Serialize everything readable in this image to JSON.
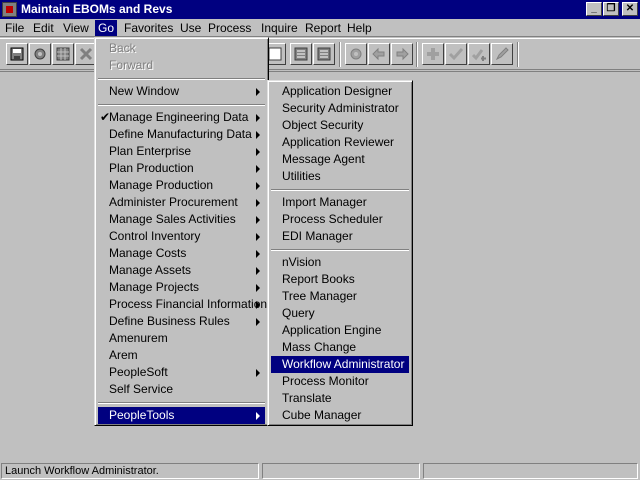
{
  "window": {
    "title": "Maintain EBOMs and Revs",
    "controls": [
      "_",
      "❐",
      "✕"
    ]
  },
  "menubar": [
    "File",
    "Edit",
    "View",
    "Go",
    "Favorites",
    "Use",
    "Process",
    "Inquire",
    "Report",
    "Help"
  ],
  "go_menu": {
    "items": [
      {
        "label": "Back",
        "disabled": true
      },
      {
        "label": "Forward",
        "disabled": true
      },
      {
        "label": "New Window",
        "submenu": true
      },
      {
        "label": "Manage Engineering Data",
        "submenu": true,
        "checked": true
      },
      {
        "label": "Define Manufacturing Data",
        "submenu": true
      },
      {
        "label": "Plan Enterprise",
        "submenu": true
      },
      {
        "label": "Plan Production",
        "submenu": true
      },
      {
        "label": "Manage Production",
        "submenu": true
      },
      {
        "label": "Administer Procurement",
        "submenu": true
      },
      {
        "label": "Manage Sales Activities",
        "submenu": true
      },
      {
        "label": "Control Inventory",
        "submenu": true
      },
      {
        "label": "Manage Costs",
        "submenu": true
      },
      {
        "label": "Manage Assets",
        "submenu": true
      },
      {
        "label": "Manage Projects",
        "submenu": true
      },
      {
        "label": "Process Financial Information",
        "submenu": true
      },
      {
        "label": "Define Business Rules",
        "submenu": true
      },
      {
        "label": "Amenurem"
      },
      {
        "label": "Arem"
      },
      {
        "label": "PeopleSoft",
        "submenu": true
      },
      {
        "label": "Self Service"
      },
      {
        "label": "PeopleTools",
        "submenu": true,
        "highlighted": true
      }
    ]
  },
  "peopletools_menu": {
    "items": [
      {
        "label": "Application Designer"
      },
      {
        "label": "Security Administrator"
      },
      {
        "label": "Object Security"
      },
      {
        "label": "Application Reviewer"
      },
      {
        "label": "Message Agent"
      },
      {
        "label": "Utilities"
      },
      {
        "label": "Import Manager"
      },
      {
        "label": "Process Scheduler"
      },
      {
        "label": "EDI Manager"
      },
      {
        "label": "nVision"
      },
      {
        "label": "Report Books"
      },
      {
        "label": "Tree Manager"
      },
      {
        "label": "Query"
      },
      {
        "label": "Application Engine"
      },
      {
        "label": "Mass Change"
      },
      {
        "label": "Workflow Administrator",
        "highlighted": true
      },
      {
        "label": "Process Monitor"
      },
      {
        "label": "Translate"
      },
      {
        "label": "Cube Manager"
      }
    ]
  },
  "statusbar": {
    "message": "Launch Workflow Administrator."
  }
}
